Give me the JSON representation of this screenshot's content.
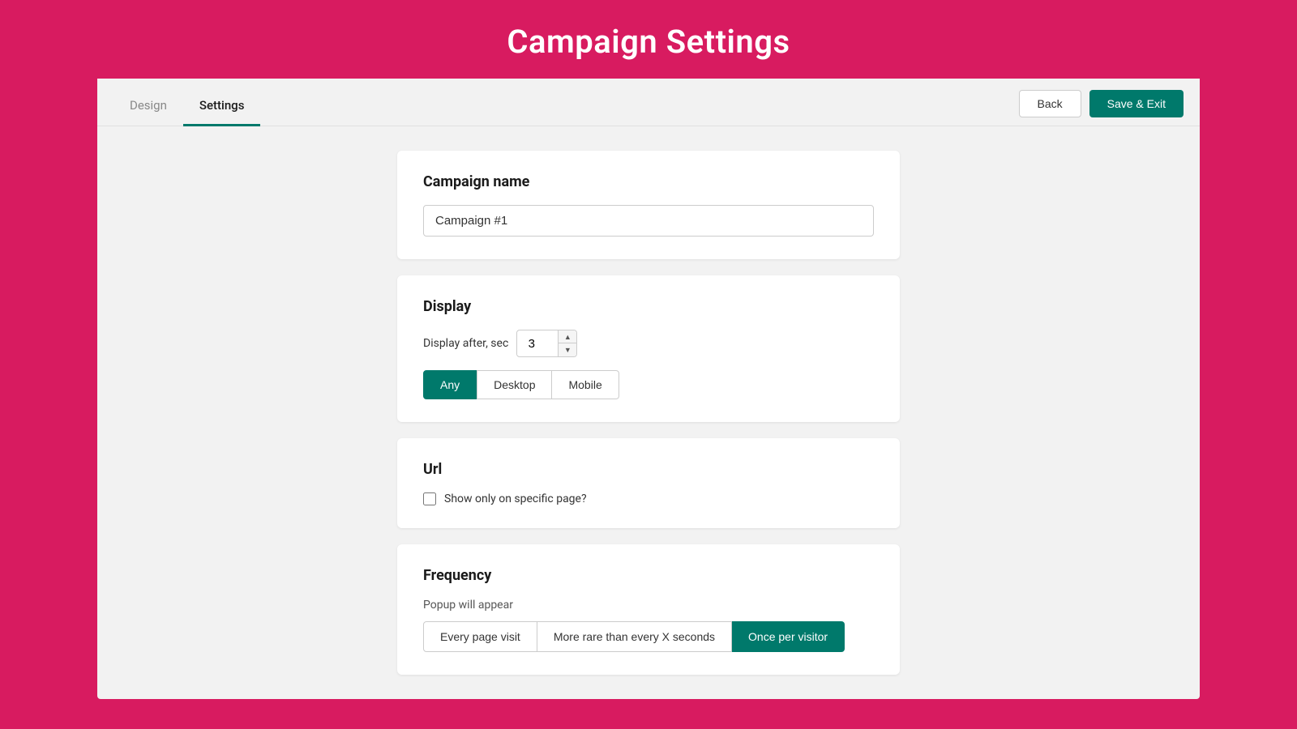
{
  "header": {
    "title": "Campaign Settings"
  },
  "nav": {
    "tabs": [
      {
        "id": "design",
        "label": "Design",
        "active": false
      },
      {
        "id": "settings",
        "label": "Settings",
        "active": true
      }
    ],
    "back_label": "Back",
    "save_label": "Save & Exit"
  },
  "campaign_name_card": {
    "title": "Campaign name",
    "input_value": "Campaign #1",
    "input_placeholder": "Campaign #1"
  },
  "display_card": {
    "title": "Display",
    "display_after_label": "Display after, sec",
    "display_after_value": "3",
    "device_buttons": [
      {
        "label": "Any",
        "active": true
      },
      {
        "label": "Desktop",
        "active": false
      },
      {
        "label": "Mobile",
        "active": false
      }
    ]
  },
  "url_card": {
    "title": "Url",
    "checkbox_label": "Show only on specific page?",
    "checkbox_checked": false
  },
  "frequency_card": {
    "title": "Frequency",
    "sub_label": "Popup will appear",
    "frequency_buttons": [
      {
        "label": "Every page visit",
        "active": false
      },
      {
        "label": "More rare than every X seconds",
        "active": false
      },
      {
        "label": "Once per visitor",
        "active": true
      }
    ]
  },
  "colors": {
    "brand_pink": "#d81b60",
    "brand_teal": "#00796b",
    "white": "#ffffff",
    "light_bg": "#f2f2f2"
  }
}
